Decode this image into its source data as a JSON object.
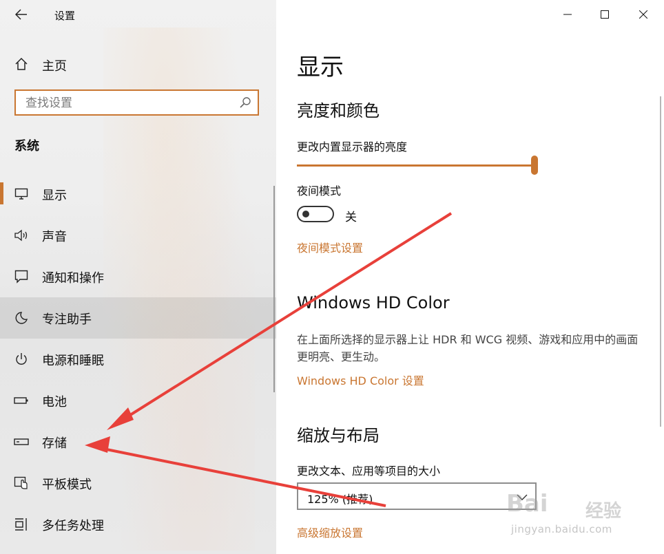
{
  "window": {
    "title": "设置"
  },
  "sidebar": {
    "home": "主页",
    "search": {
      "placeholder": "查找设置"
    },
    "section": "系统",
    "items": [
      {
        "label": "显示",
        "icon": "monitor-icon"
      },
      {
        "label": "声音",
        "icon": "speaker-icon"
      },
      {
        "label": "通知和操作",
        "icon": "notification-icon"
      },
      {
        "label": "专注助手",
        "icon": "moon-icon"
      },
      {
        "label": "电源和睡眠",
        "icon": "power-icon"
      },
      {
        "label": "电池",
        "icon": "battery-icon"
      },
      {
        "label": "存储",
        "icon": "storage-icon"
      },
      {
        "label": "平板模式",
        "icon": "tablet-icon"
      },
      {
        "label": "多任务处理",
        "icon": "multitask-icon"
      }
    ]
  },
  "content": {
    "title": "显示",
    "brightness": {
      "heading": "亮度和颜色",
      "label": "更改内置显示器的亮度",
      "value": 100
    },
    "night_mode": {
      "label": "夜间模式",
      "state": "关",
      "link": "夜间模式设置"
    },
    "hdr": {
      "heading": "Windows HD Color",
      "description": "在上面所选择的显示器上让 HDR 和 WCG 视频、游戏和应用中的画面更明亮、更生动。",
      "link": "Windows HD Color 设置"
    },
    "scale": {
      "heading": "缩放与布局",
      "label": "更改文本、应用等项目的大小",
      "selected": "125% (推荐)",
      "link": "高级缩放设置"
    }
  },
  "watermark": {
    "brand": "Bai",
    "brand_cn": "经验",
    "url": "jingyan.baidu.com"
  },
  "colors": {
    "accent": "#c97631",
    "arrow": "#e8403a"
  }
}
